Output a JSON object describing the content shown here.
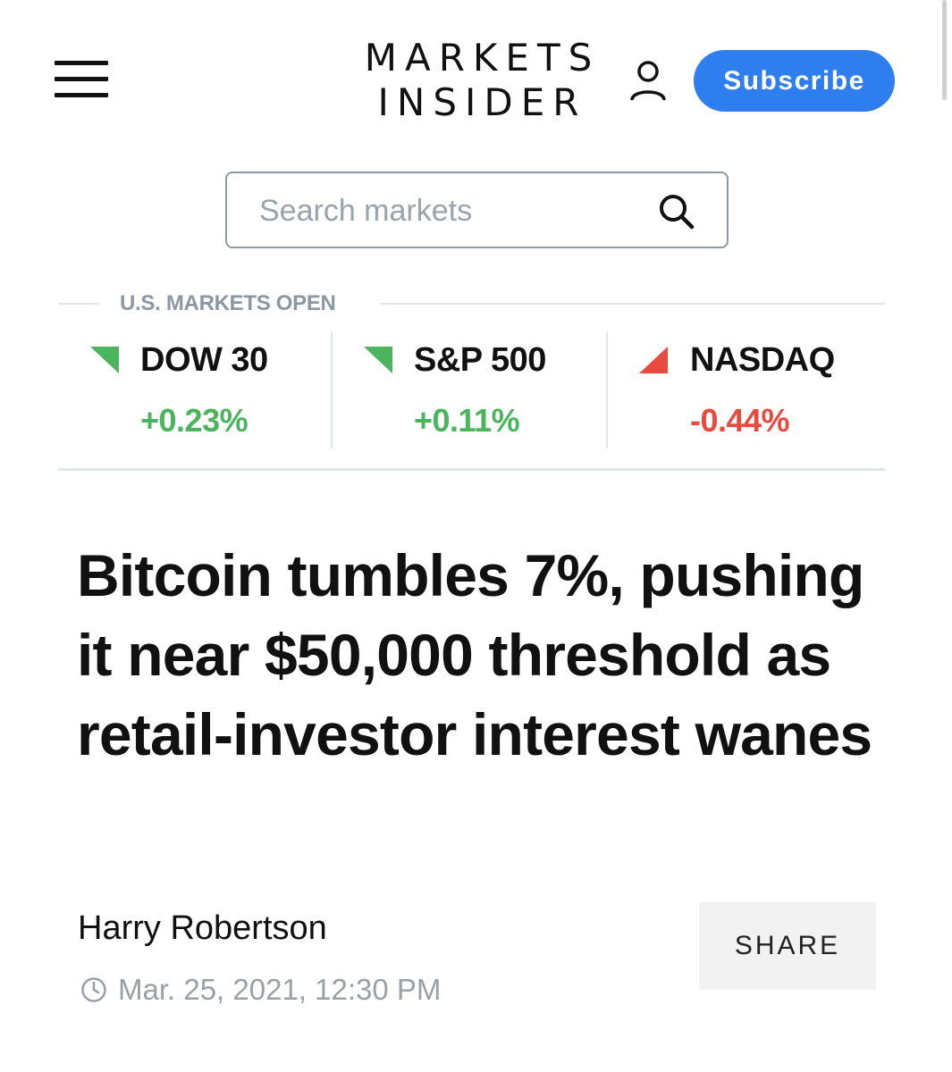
{
  "header": {
    "menu_icon": "hamburger-menu-icon",
    "logo_line1": "MARKETS",
    "logo_line2": "INSIDER",
    "user_icon": "user-account-icon",
    "subscribe_label": "Subscribe",
    "colors": {
      "subscribe_bg": "#2f7ef0",
      "text": "#111111"
    }
  },
  "search": {
    "placeholder": "Search markets",
    "value": "",
    "icon": "search-icon"
  },
  "markets": {
    "status": "U.S. MARKETS OPEN",
    "indices": [
      {
        "name": "DOW 30",
        "change": "+0.23%",
        "direction": "down-arrow-icon",
        "color": "#4ab55c"
      },
      {
        "name": "S&P 500",
        "change": "+0.11%",
        "direction": "down-arrow-icon",
        "color": "#4ab55c"
      },
      {
        "name": "NASDAQ",
        "change": "-0.44%",
        "direction": "up-arrow-icon",
        "color": "#e84a3f"
      }
    ]
  },
  "article": {
    "headline": "Bitcoin tumbles 7%, pushing it near $50,000 threshold as retail-investor interest wanes",
    "author": "Harry Robertson",
    "date": "Mar. 25, 2021, 12:30 PM",
    "clock_icon": "clock-icon",
    "share_label": "SHARE"
  }
}
